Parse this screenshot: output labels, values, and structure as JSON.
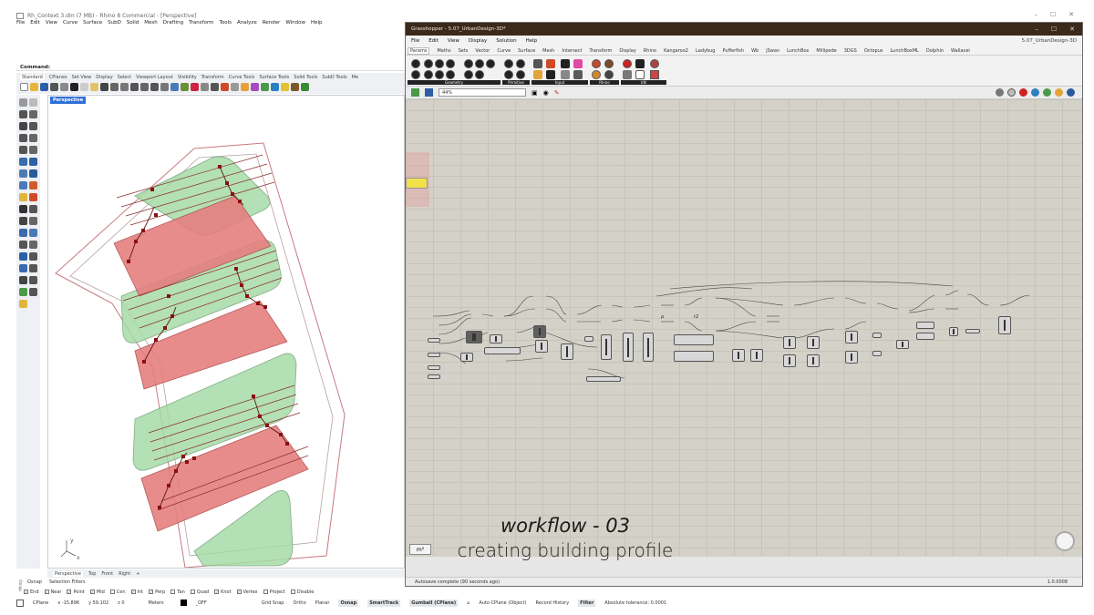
{
  "rhino": {
    "title": "Rh_Context 3.dm (7 MB) - Rhino 8 Commercial - [Perspective]",
    "menu": [
      "File",
      "Edit",
      "View",
      "Curve",
      "Surface",
      "SubD",
      "Solid",
      "Mesh",
      "Drafting",
      "Transform",
      "Tools",
      "Analyze",
      "Render",
      "Window",
      "Help"
    ],
    "command_label": "Command:",
    "toolbar_tabs": [
      "Standard",
      "CPlanes",
      "Set View",
      "Display",
      "Select",
      "Viewport Layout",
      "Visibility",
      "Transform",
      "Curve Tools",
      "Surface Tools",
      "Solid Tools",
      "SubD Tools",
      "Me"
    ],
    "viewport_label": "Perspective",
    "viewport_tabs": [
      "Perspective",
      "Top",
      "Front",
      "Right",
      "+"
    ],
    "osnap_header": [
      "Osnap",
      "Selection Filters"
    ],
    "osnaps": [
      {
        "label": "End",
        "checked": true
      },
      {
        "label": "Near",
        "checked": true
      },
      {
        "label": "Point",
        "checked": true
      },
      {
        "label": "Mid",
        "checked": true
      },
      {
        "label": "Cen",
        "checked": false
      },
      {
        "label": "Int",
        "checked": true
      },
      {
        "label": "Perp",
        "checked": true
      },
      {
        "label": "Tan",
        "checked": false
      },
      {
        "label": "Quad",
        "checked": false
      },
      {
        "label": "Knot",
        "checked": true
      },
      {
        "label": "Vertex",
        "checked": true
      },
      {
        "label": "Project",
        "checked": false
      },
      {
        "label": "Disable",
        "checked": false
      }
    ],
    "status": {
      "cplane": "CPlane",
      "x": "x -15.896",
      "y": "y 59.102",
      "z": "z 0",
      "units": "Meters",
      "layer": "_OFF",
      "grid_snap": "Grid Snap",
      "ortho": "Ortho",
      "planar": "Planar",
      "osnap": "Osnap",
      "smarttrack": "SmartTrack",
      "gumball": "Gumball (CPlane)",
      "autocplane": "Auto CPlane (Object)",
      "record_history": "Record History",
      "filter": "Filter",
      "tolerance": "Absolute tolerance: 0.0001"
    },
    "side_osnap": "Osnap"
  },
  "grasshopper": {
    "title": "Grasshopper - 5.07_UrbanDesign-3D*",
    "menu": [
      "File",
      "Edit",
      "View",
      "Display",
      "Solution",
      "Help"
    ],
    "doc_name": "5.07_UrbanDesign-3D",
    "tabs": [
      "Params",
      "Maths",
      "Sets",
      "Vector",
      "Curve",
      "Surface",
      "Mesh",
      "Intersect",
      "Transform",
      "Display",
      "Rhino",
      "Kangaroo2",
      "Ladybug",
      "Pufferfish",
      "Wb",
      "jSwan",
      "LunchBox",
      "Millipede",
      "3DGS",
      "Octopus",
      "LunchBoxML",
      "Dolphin",
      "Wallacei"
    ],
    "ribbon_groups": [
      "Geometry",
      "Primitive",
      "Input",
      "Rhino",
      "Util"
    ],
    "zoom": "44%",
    "status_text": "Autosave complete (90 seconds ago)",
    "version": "1.0.0008"
  },
  "overlay": {
    "title": "workflow - 03",
    "subtitle": "creating building profile"
  }
}
